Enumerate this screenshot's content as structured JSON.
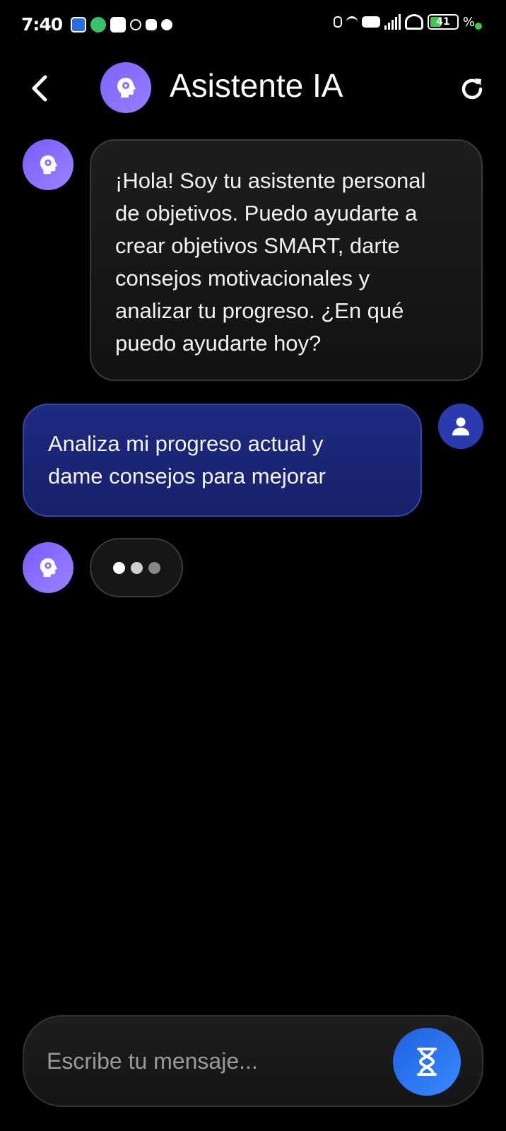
{
  "status_bar": {
    "time": "7:40",
    "battery_text": "41",
    "battery_pct_symbol": "%",
    "battery_level": 0.41,
    "colors": {
      "battery": "#3ec94a"
    }
  },
  "header": {
    "title": "Asistente IA",
    "back_icon": "chevron-left-icon",
    "avatar_icon": "head-brain-icon",
    "refresh_icon": "refresh-icon"
  },
  "messages": [
    {
      "role": "assistant",
      "text": "¡Hola! Soy tu asistente personal\nde objetivos. Puedo ayudarte a\ncrear objetivos SMART, darte\nconsejos motivacionales y\nanalizar tu progreso. ¿En qué\npuedo ayudarte hoy?"
    },
    {
      "role": "user",
      "text": "Analiza mi progreso actual y\ndame consejos para mejorar"
    },
    {
      "role": "assistant",
      "typing": true
    }
  ],
  "input": {
    "placeholder": "Escribe tu mensaje...",
    "value": "",
    "send_icon": "hourglass-icon"
  },
  "colors": {
    "background": "#000000",
    "bot_avatar": "#8a6fff",
    "user_bubble": "#1f2a80",
    "user_avatar": "#2a3bb0",
    "send_button": "#2b76f0"
  }
}
